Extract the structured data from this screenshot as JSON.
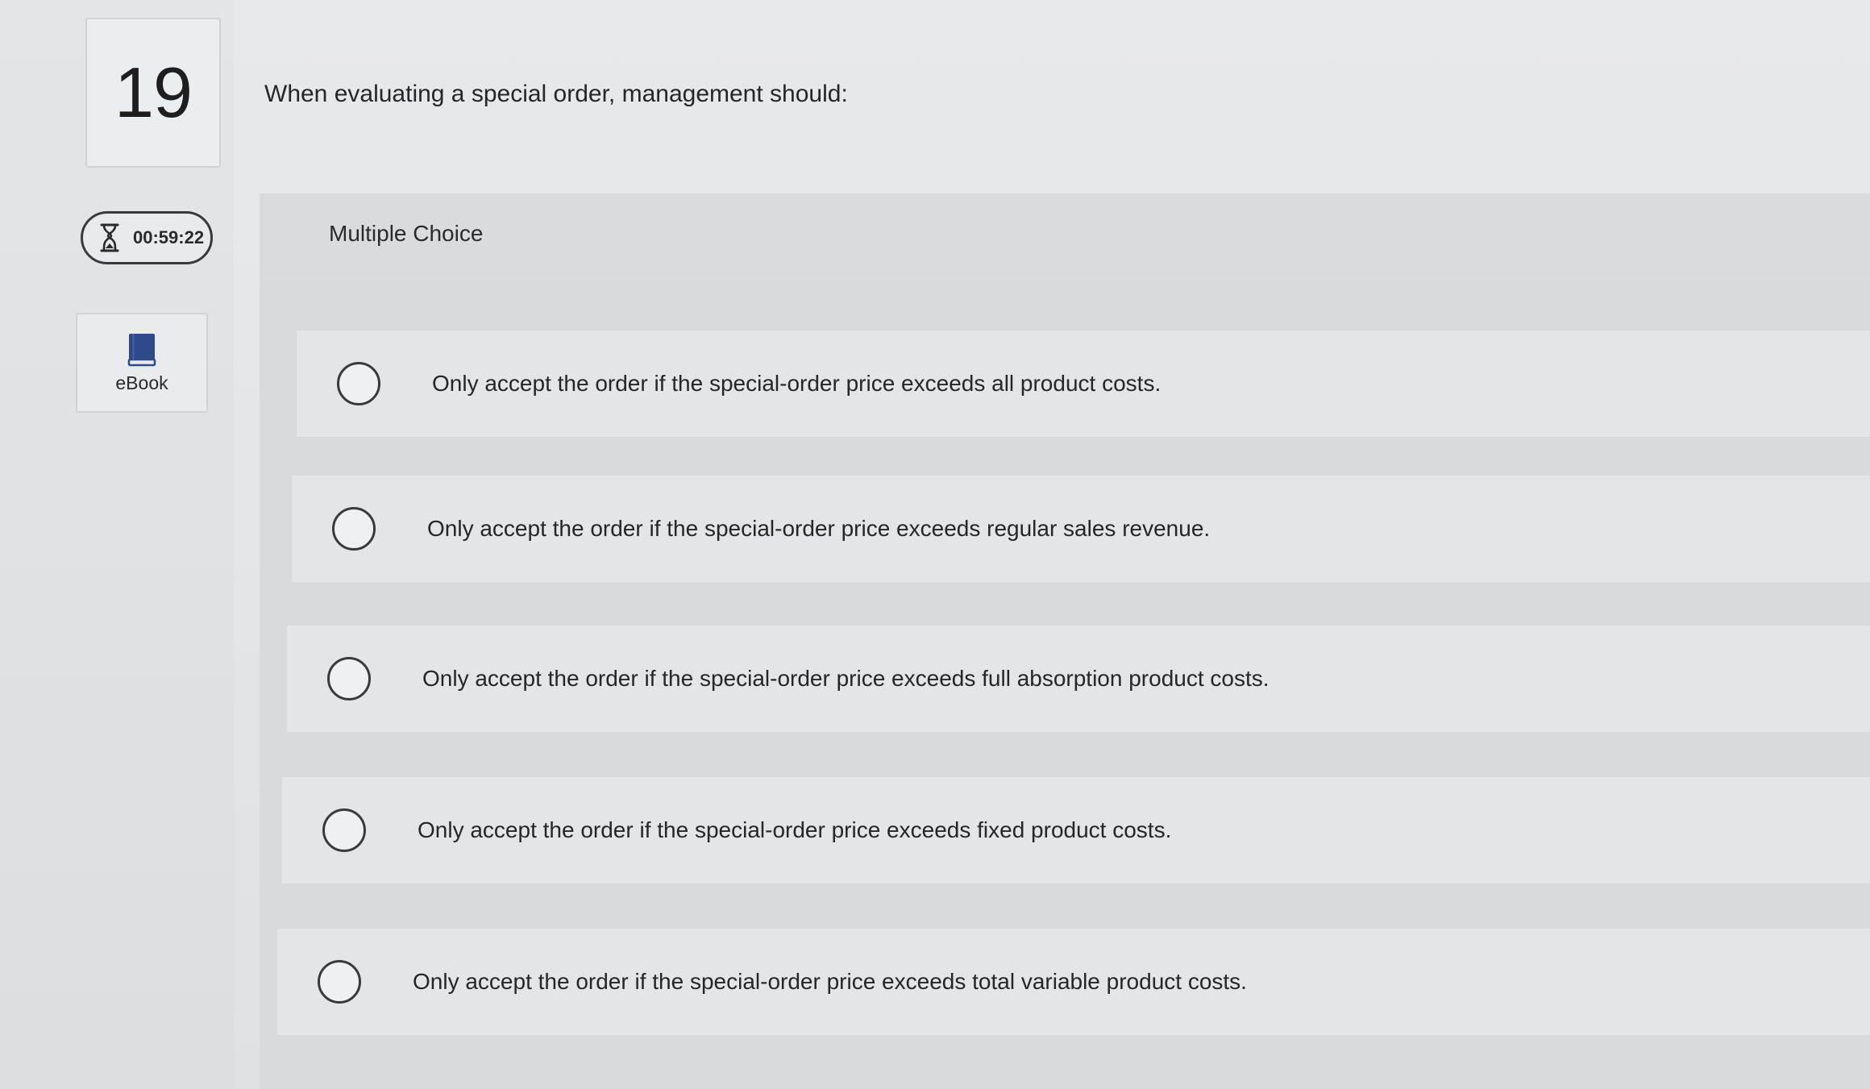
{
  "question": {
    "number": "19",
    "text": "When evaluating a special order, management should:",
    "type_label": "Multiple Choice"
  },
  "timer": {
    "icon": "hourglass-icon",
    "value": "00:59:22"
  },
  "ebook": {
    "icon": "book-icon",
    "label": "eBook",
    "icon_color": "#2f4a8a"
  },
  "options": [
    {
      "text": "Only accept the order if the special-order price exceeds all product costs."
    },
    {
      "text": "Only accept the order if the special-order price exceeds regular sales revenue."
    },
    {
      "text": "Only accept the order if the special-order price exceeds full absorption product costs."
    },
    {
      "text": "Only accept the order if the special-order price exceeds fixed product costs."
    },
    {
      "text": "Only accept the order if the special-order price exceeds total variable product costs."
    }
  ]
}
